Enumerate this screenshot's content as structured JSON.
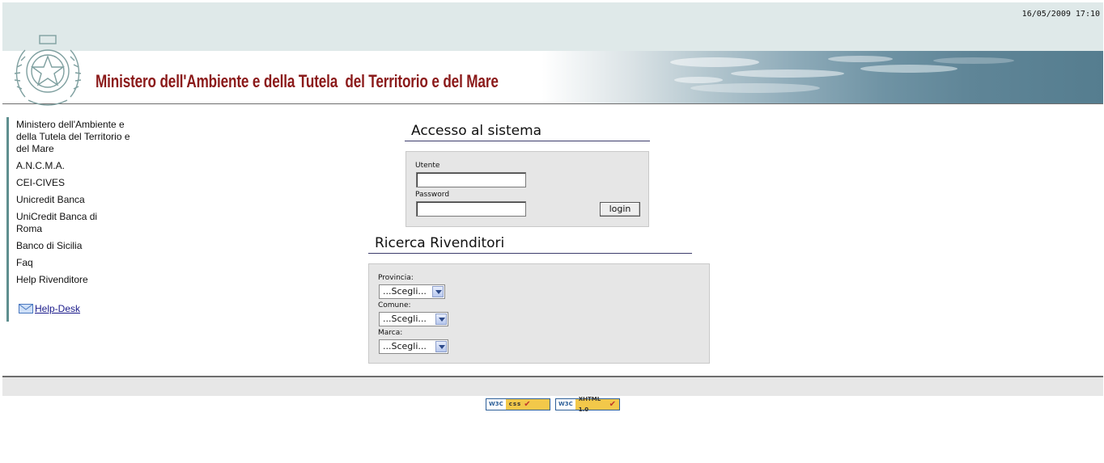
{
  "header": {
    "datetime": "16/05/2009 17:10",
    "title": "Ministero dell'Ambiente e della Tutela  del Territorio e del Mare",
    "emblem_icon": "italian-republic-emblem-icon"
  },
  "sidebar": {
    "items": [
      {
        "label": "Ministero dell'Ambiente e della Tutela del Territorio e del Mare"
      },
      {
        "label": "A.N.C.M.A."
      },
      {
        "label": "CEI-CIVES"
      },
      {
        "label": "Unicredit Banca"
      },
      {
        "label": "UniCredit Banca di Roma"
      },
      {
        "label": "Banco di Sicilia"
      },
      {
        "label": "Faq"
      },
      {
        "label": "Help Rivenditore"
      }
    ],
    "helpdesk": {
      "label": "Help-Desk",
      "icon": "envelope-icon"
    }
  },
  "login": {
    "title": "Accesso al sistema",
    "user_label": "Utente",
    "user_value": "",
    "password_label": "Password",
    "password_value": "",
    "button_label": "login"
  },
  "search": {
    "title": "Ricerca Rivenditori",
    "provincia_label": "Provincia:",
    "provincia_value": "...Scegli...",
    "comune_label": "Comune:",
    "comune_value": "...Scegli...",
    "marca_label": "Marca:",
    "marca_value": "...Scegli..."
  },
  "footer": {
    "css_badge": {
      "prefix": "W3C",
      "label": "css"
    },
    "xhtml_badge": {
      "prefix": "W3C",
      "label": "XHTML 1.0"
    }
  },
  "colors": {
    "title_red": "#8b1a1a",
    "nav_bar": "#5e8f8f",
    "top_band": "#dfe9e9"
  }
}
